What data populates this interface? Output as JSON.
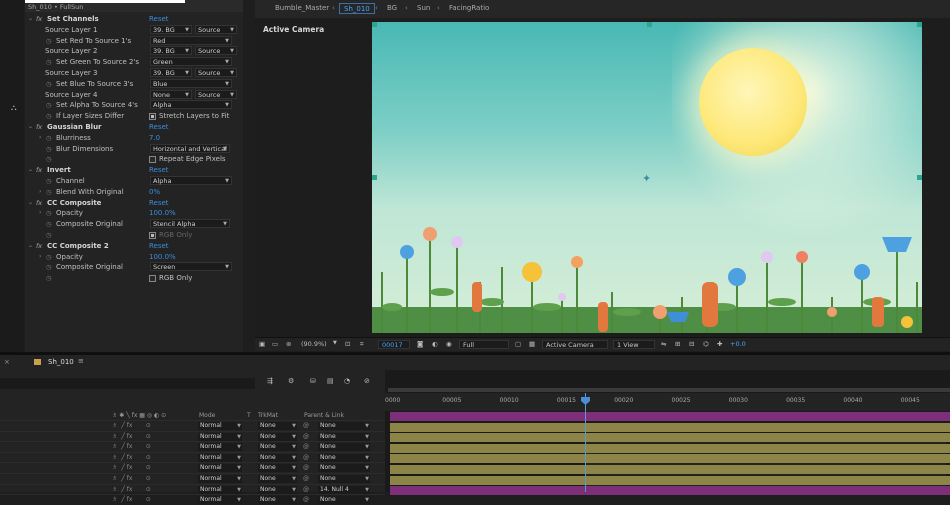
{
  "effect_controls": {
    "header": "Sh_010 • FullSun",
    "rows": [
      {
        "type": "effect",
        "name": "Set Channels",
        "reset": "Reset"
      },
      {
        "type": "prop",
        "name": "Source Layer 1",
        "dd1": "39. BG",
        "dd2": "Source"
      },
      {
        "type": "prop2",
        "name": "Set Red To Source 1's",
        "dd": "Red"
      },
      {
        "type": "prop",
        "name": "Source Layer 2",
        "dd1": "39. BG",
        "dd2": "Source"
      },
      {
        "type": "prop2",
        "name": "Set Green To Source 2's",
        "dd": "Green"
      },
      {
        "type": "prop",
        "name": "Source Layer 3",
        "dd1": "39. BG",
        "dd2": "Source"
      },
      {
        "type": "prop2",
        "name": "Set Blue To Source 3's",
        "dd": "Blue"
      },
      {
        "type": "prop",
        "name": "Source Layer 4",
        "dd1": "None",
        "dd2": "Source"
      },
      {
        "type": "prop2",
        "name": "Set Alpha To Source 4's",
        "dd": "Alpha"
      },
      {
        "type": "check",
        "name": "If Layer Sizes Differ",
        "label": "Stretch Layers to Fit",
        "checked": true
      },
      {
        "type": "effect",
        "name": "Gaussian Blur",
        "reset": "Reset"
      },
      {
        "type": "val",
        "name": "Blurriness",
        "value": "7.0"
      },
      {
        "type": "prop2",
        "name": "Blur Dimensions",
        "dd": "Horizontal and Vertical"
      },
      {
        "type": "check",
        "name": "",
        "label": "Repeat Edge Pixels",
        "checked": false
      },
      {
        "type": "effect",
        "name": "Invert",
        "reset": "Reset"
      },
      {
        "type": "prop2",
        "name": "Channel",
        "dd": "Alpha"
      },
      {
        "type": "val",
        "name": "Blend With Original",
        "value": "0%"
      },
      {
        "type": "effect",
        "name": "CC Composite",
        "reset": "Reset"
      },
      {
        "type": "val",
        "name": "Opacity",
        "value": "100.0%"
      },
      {
        "type": "prop2",
        "name": "Composite Original",
        "dd": "Stencil Alpha"
      },
      {
        "type": "check",
        "name": "",
        "label": "RGB Only",
        "checked": true,
        "dim": true
      },
      {
        "type": "effect",
        "name": "CC Composite 2",
        "reset": "Reset"
      },
      {
        "type": "val",
        "name": "Opacity",
        "value": "100.0%"
      },
      {
        "type": "prop2",
        "name": "Composite Original",
        "dd": "Screen"
      },
      {
        "type": "check",
        "name": "",
        "label": "RGB Only",
        "checked": false
      }
    ]
  },
  "composition": {
    "breadcrumbs": [
      "Bumble_Master",
      "Sh_010",
      "BG",
      "Sun",
      "FacingRatio"
    ],
    "active_tab_index": 1,
    "viewer_label": "Active Camera",
    "toolbar": {
      "zoom": "(90.9%)",
      "timecode": "00017",
      "resolution": "Full",
      "camera": "Active Camera",
      "views": "1 View",
      "exposure": "+0.0"
    },
    "colors": {
      "accent": "#4aa3ff",
      "sky_top": "#49b8b4",
      "sun": "#fde878"
    }
  },
  "timeline": {
    "comp_name": "Sh_010",
    "headers": {
      "mode": "Mode",
      "t": "T",
      "trkmat": "TrkMat",
      "parent": "Parent & Link"
    },
    "ticks": [
      "0000",
      "00005",
      "00010",
      "00015",
      "00020",
      "00025",
      "00030",
      "00035",
      "00040",
      "00045"
    ],
    "layers": [
      {
        "mode": "Normal",
        "trkmat": "None",
        "parent": "None",
        "color": "purple"
      },
      {
        "mode": "Normal",
        "trkmat": "None",
        "parent": "None",
        "color": "olive"
      },
      {
        "mode": "Normal",
        "trkmat": "None",
        "parent": "None",
        "color": "olive"
      },
      {
        "mode": "Normal",
        "trkmat": "None",
        "parent": "None",
        "color": "olive"
      },
      {
        "mode": "Normal",
        "trkmat": "None",
        "parent": "None",
        "color": "olive"
      },
      {
        "mode": "Normal",
        "trkmat": "None",
        "parent": "None",
        "color": "olive"
      },
      {
        "mode": "Normal",
        "trkmat": "None",
        "parent": "14. Null 4",
        "color": "olive"
      },
      {
        "mode": "Normal",
        "trkmat": "None",
        "parent": "None",
        "color": "purple"
      }
    ]
  }
}
